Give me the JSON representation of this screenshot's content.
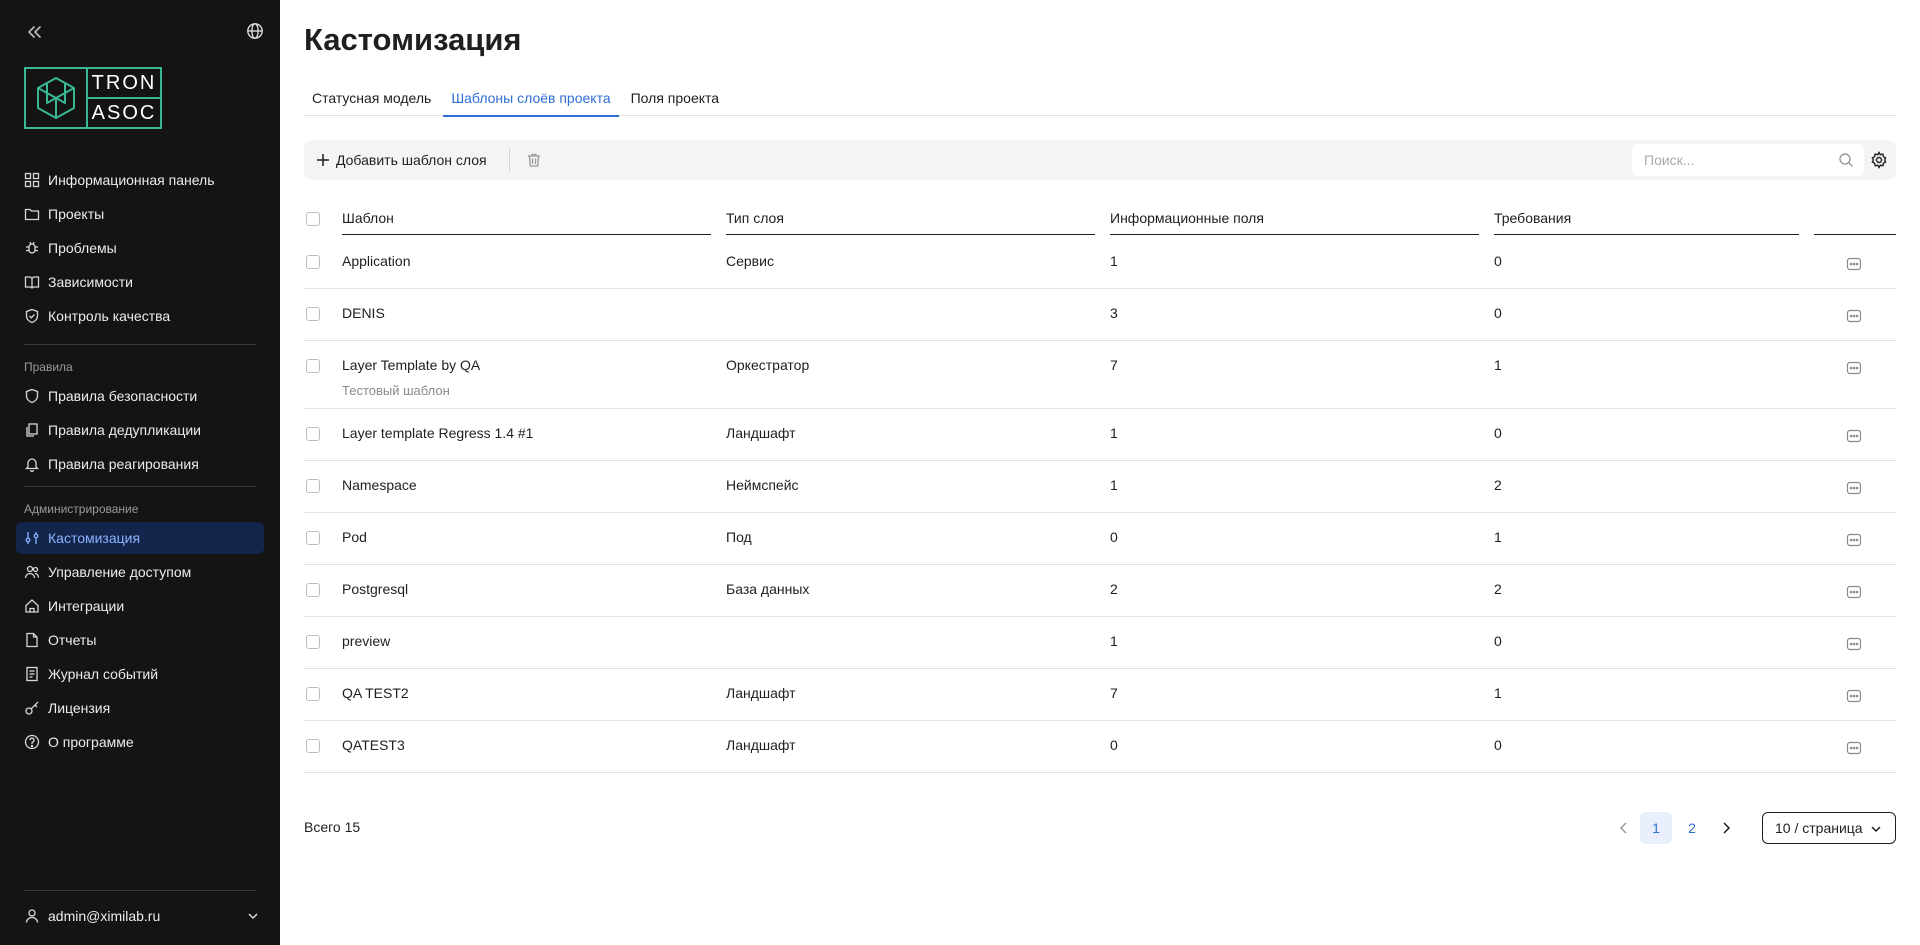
{
  "sidebar": {
    "logo": {
      "line1": "TRON",
      "line2": "ASOC",
      "accent": "#3ab795"
    },
    "nav_main": [
      {
        "label": "Информационная панель",
        "icon": "dashboard-icon"
      },
      {
        "label": "Проекты",
        "icon": "folder-icon"
      },
      {
        "label": "Проблемы",
        "icon": "bug-icon"
      },
      {
        "label": "Зависимости",
        "icon": "book-icon"
      },
      {
        "label": "Контроль качества",
        "icon": "shield-check-icon"
      }
    ],
    "section_rules": "Правила",
    "nav_rules": [
      {
        "label": "Правила безопасности",
        "icon": "shield-icon"
      },
      {
        "label": "Правила дедупликации",
        "icon": "copy-icon"
      },
      {
        "label": "Правила реагирования",
        "icon": "bell-icon"
      }
    ],
    "section_admin": "Администрирование",
    "nav_admin": [
      {
        "label": "Кастомизация",
        "icon": "sliders-icon",
        "active": true
      },
      {
        "label": "Управление доступом",
        "icon": "users-icon"
      },
      {
        "label": "Интеграции",
        "icon": "home-icon"
      },
      {
        "label": "Отчеты",
        "icon": "document-icon"
      },
      {
        "label": "Журнал событий",
        "icon": "journal-icon"
      },
      {
        "label": "Лицензия",
        "icon": "key-icon"
      },
      {
        "label": "О программе",
        "icon": "question-icon"
      }
    ],
    "user": "admin@ximilab.ru"
  },
  "main": {
    "title": "Кастомизация",
    "tabs": [
      {
        "label": "Статусная модель"
      },
      {
        "label": "Шаблоны слоёв проекта",
        "active": true
      },
      {
        "label": "Поля проекта"
      }
    ],
    "toolbar": {
      "add_label": "Добавить шаблон слоя",
      "search_placeholder": "Поиск..."
    },
    "table": {
      "columns": [
        "Шаблон",
        "Тип слоя",
        "Информационные поля",
        "Требования"
      ],
      "rows": [
        {
          "name": "Application",
          "type": "Сервис",
          "fields": "1",
          "req": "0"
        },
        {
          "name": "DENIS",
          "type": "",
          "fields": "3",
          "req": "0"
        },
        {
          "name": "Layer Template by QA",
          "desc": "Тестовый шаблон",
          "type": "Оркестратор",
          "fields": "7",
          "req": "1"
        },
        {
          "name": "Layer template Regress 1.4 #1",
          "type": "Ландшафт",
          "fields": "1",
          "req": "0"
        },
        {
          "name": "Namespace",
          "type": "Неймспейс",
          "fields": "1",
          "req": "2"
        },
        {
          "name": "Pod",
          "type": "Под",
          "fields": "0",
          "req": "1"
        },
        {
          "name": "Postgresql",
          "type": "База данных",
          "fields": "2",
          "req": "2"
        },
        {
          "name": "preview",
          "type": "",
          "fields": "1",
          "req": "0"
        },
        {
          "name": "QA TEST2",
          "type": "Ландшафт",
          "fields": "7",
          "req": "1"
        },
        {
          "name": "QATEST3",
          "type": "Ландшафт",
          "fields": "0",
          "req": "0"
        }
      ]
    },
    "footer": {
      "total": "Всего 15",
      "pages": [
        "1",
        "2"
      ],
      "current_page": "1",
      "per_page": "10 / страница"
    }
  },
  "colors": {
    "sidebar_bg": "#141414",
    "accent_blue": "#2f6fd6",
    "active_nav_bg": "#13254a"
  }
}
